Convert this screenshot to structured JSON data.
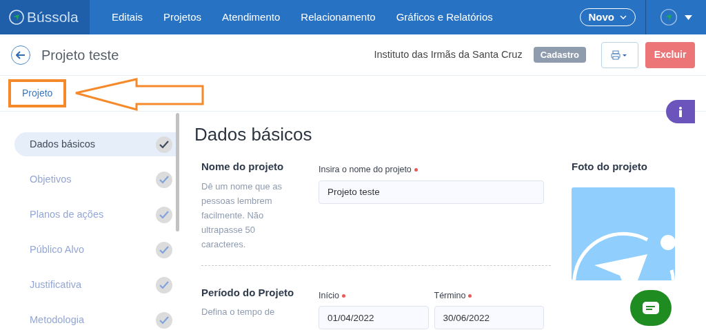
{
  "brand": "Bússola",
  "nav": [
    {
      "label": "Editais"
    },
    {
      "label": "Projetos"
    },
    {
      "label": "Atendimento"
    },
    {
      "label": "Relacionamento"
    },
    {
      "label": "Gráficos e Relatórios"
    }
  ],
  "new_button": "Novo",
  "header": {
    "title": "Projeto teste",
    "organization": "Instituto das Irmãs da Santa Cruz",
    "status": "Cadastro",
    "delete_button": "Excluir"
  },
  "tabs": [
    {
      "label": "Projeto",
      "selected": true
    }
  ],
  "steps": [
    {
      "label": "Dados básicos",
      "selected": true,
      "completed": true
    },
    {
      "label": "Objetivos",
      "selected": false,
      "completed": true
    },
    {
      "label": "Planos de ações",
      "selected": false,
      "completed": true
    },
    {
      "label": "Público Alvo",
      "selected": false,
      "completed": true
    },
    {
      "label": "Justificativa",
      "selected": false,
      "completed": true
    },
    {
      "label": "Metodologia",
      "selected": false,
      "completed": true
    }
  ],
  "section_title": "Dados básicos",
  "fields": [
    {
      "heading": "Nome do projeto",
      "help": "Dê um nome que as pessoas lembrem facilmente. Não ultrapasse 50 caracteres.",
      "inputs": [
        {
          "label": "Insira o nome do projeto",
          "required": true,
          "value": "Projeto teste"
        }
      ]
    },
    {
      "heading": "Período do Projeto",
      "help": "Defina o tempo de",
      "inputs": [
        {
          "label": "Início",
          "required": true,
          "value": "01/04/2022"
        },
        {
          "label": "Término",
          "required": true,
          "value": "30/06/2022"
        }
      ]
    }
  ],
  "photo": {
    "label": "Foto do projeto"
  }
}
